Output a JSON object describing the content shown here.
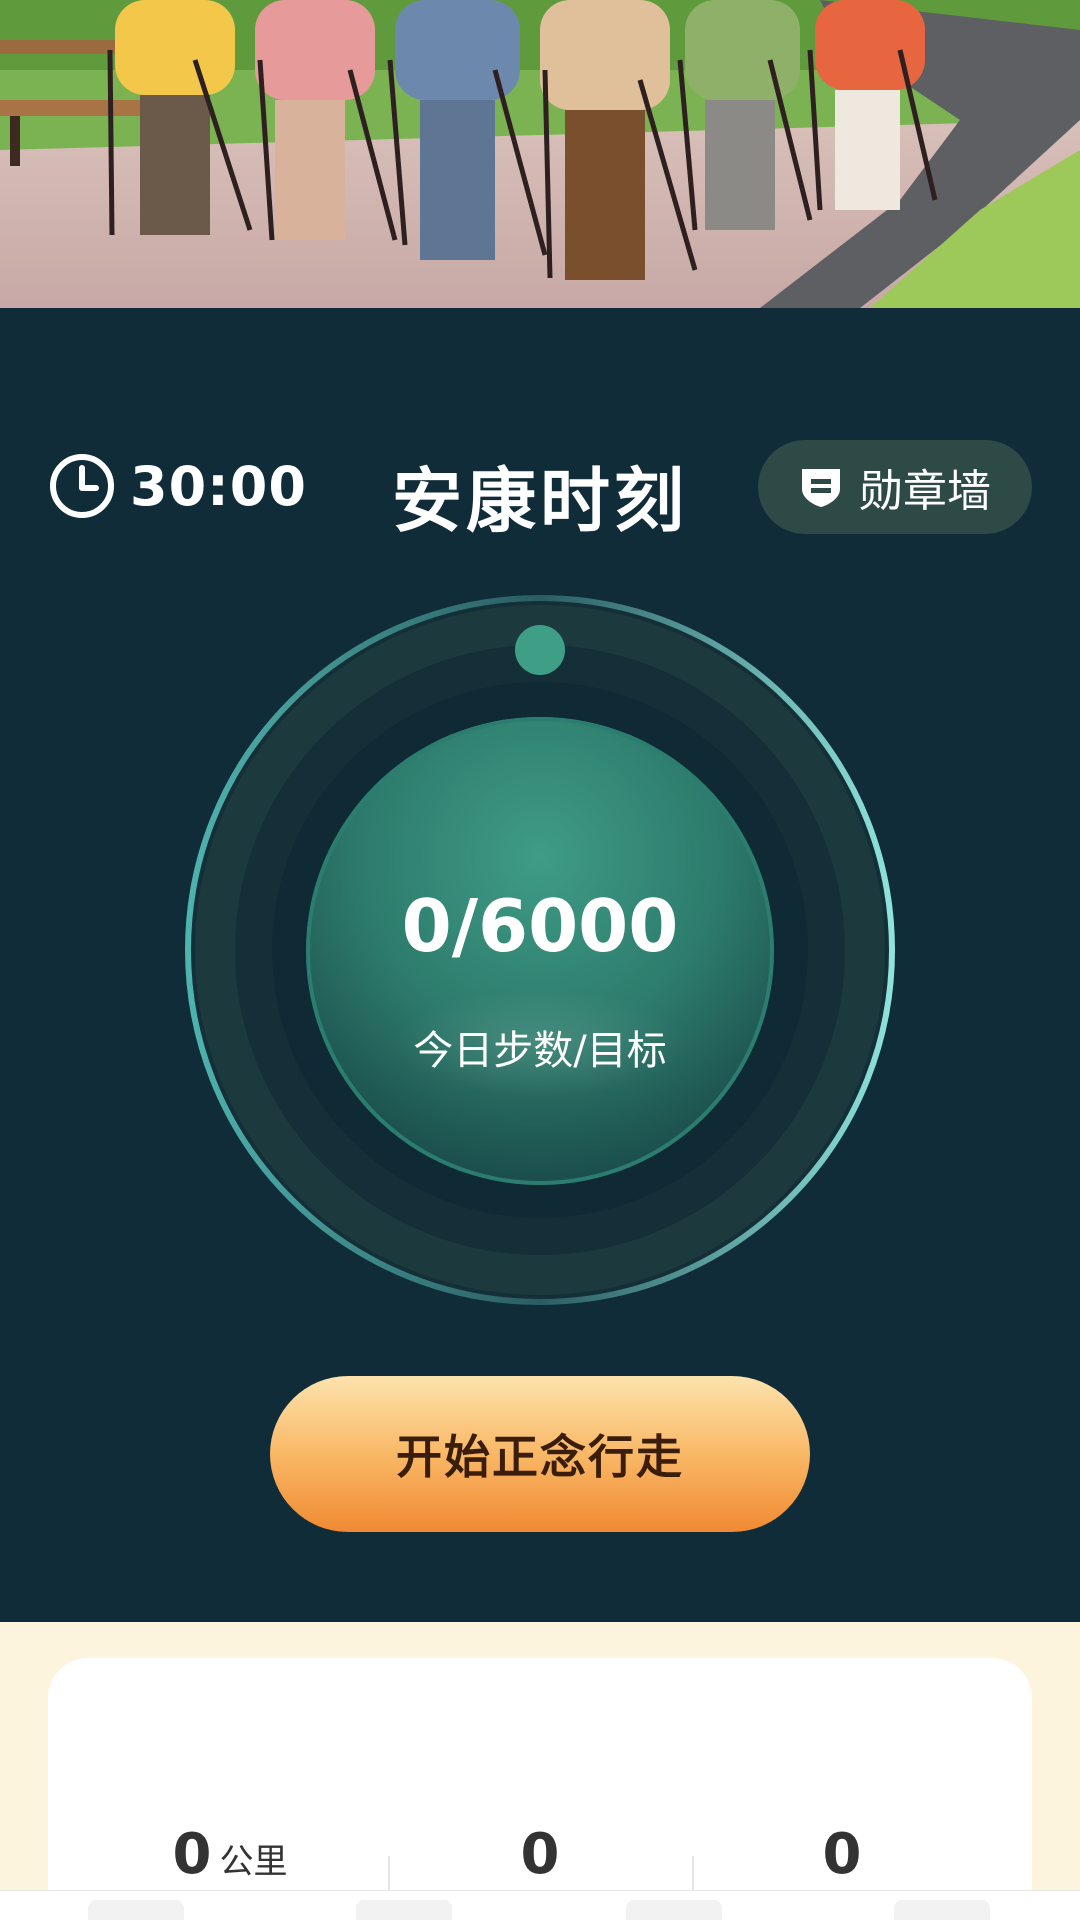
{
  "header": {
    "timer": "30:00",
    "title": "安康时刻",
    "badge_wall_label": "勋章墙"
  },
  "progress": {
    "steps_text": "0/6000",
    "steps_current": 0,
    "steps_goal": 6000,
    "label": "今日步数/目标"
  },
  "actions": {
    "start_label": "开始正念行走"
  },
  "stats": [
    {
      "value": "0",
      "unit": "公里"
    },
    {
      "value": "0",
      "unit": ""
    },
    {
      "value": "0",
      "unit": ""
    }
  ],
  "colors": {
    "panel_bg": "#102c38",
    "accent_teal": "#3a9a84",
    "button_orange": "#f5a34a",
    "bottom_bg": "#fdf4de"
  },
  "icons": {
    "timer": "clock-icon",
    "badge": "badge-shield-icon"
  }
}
